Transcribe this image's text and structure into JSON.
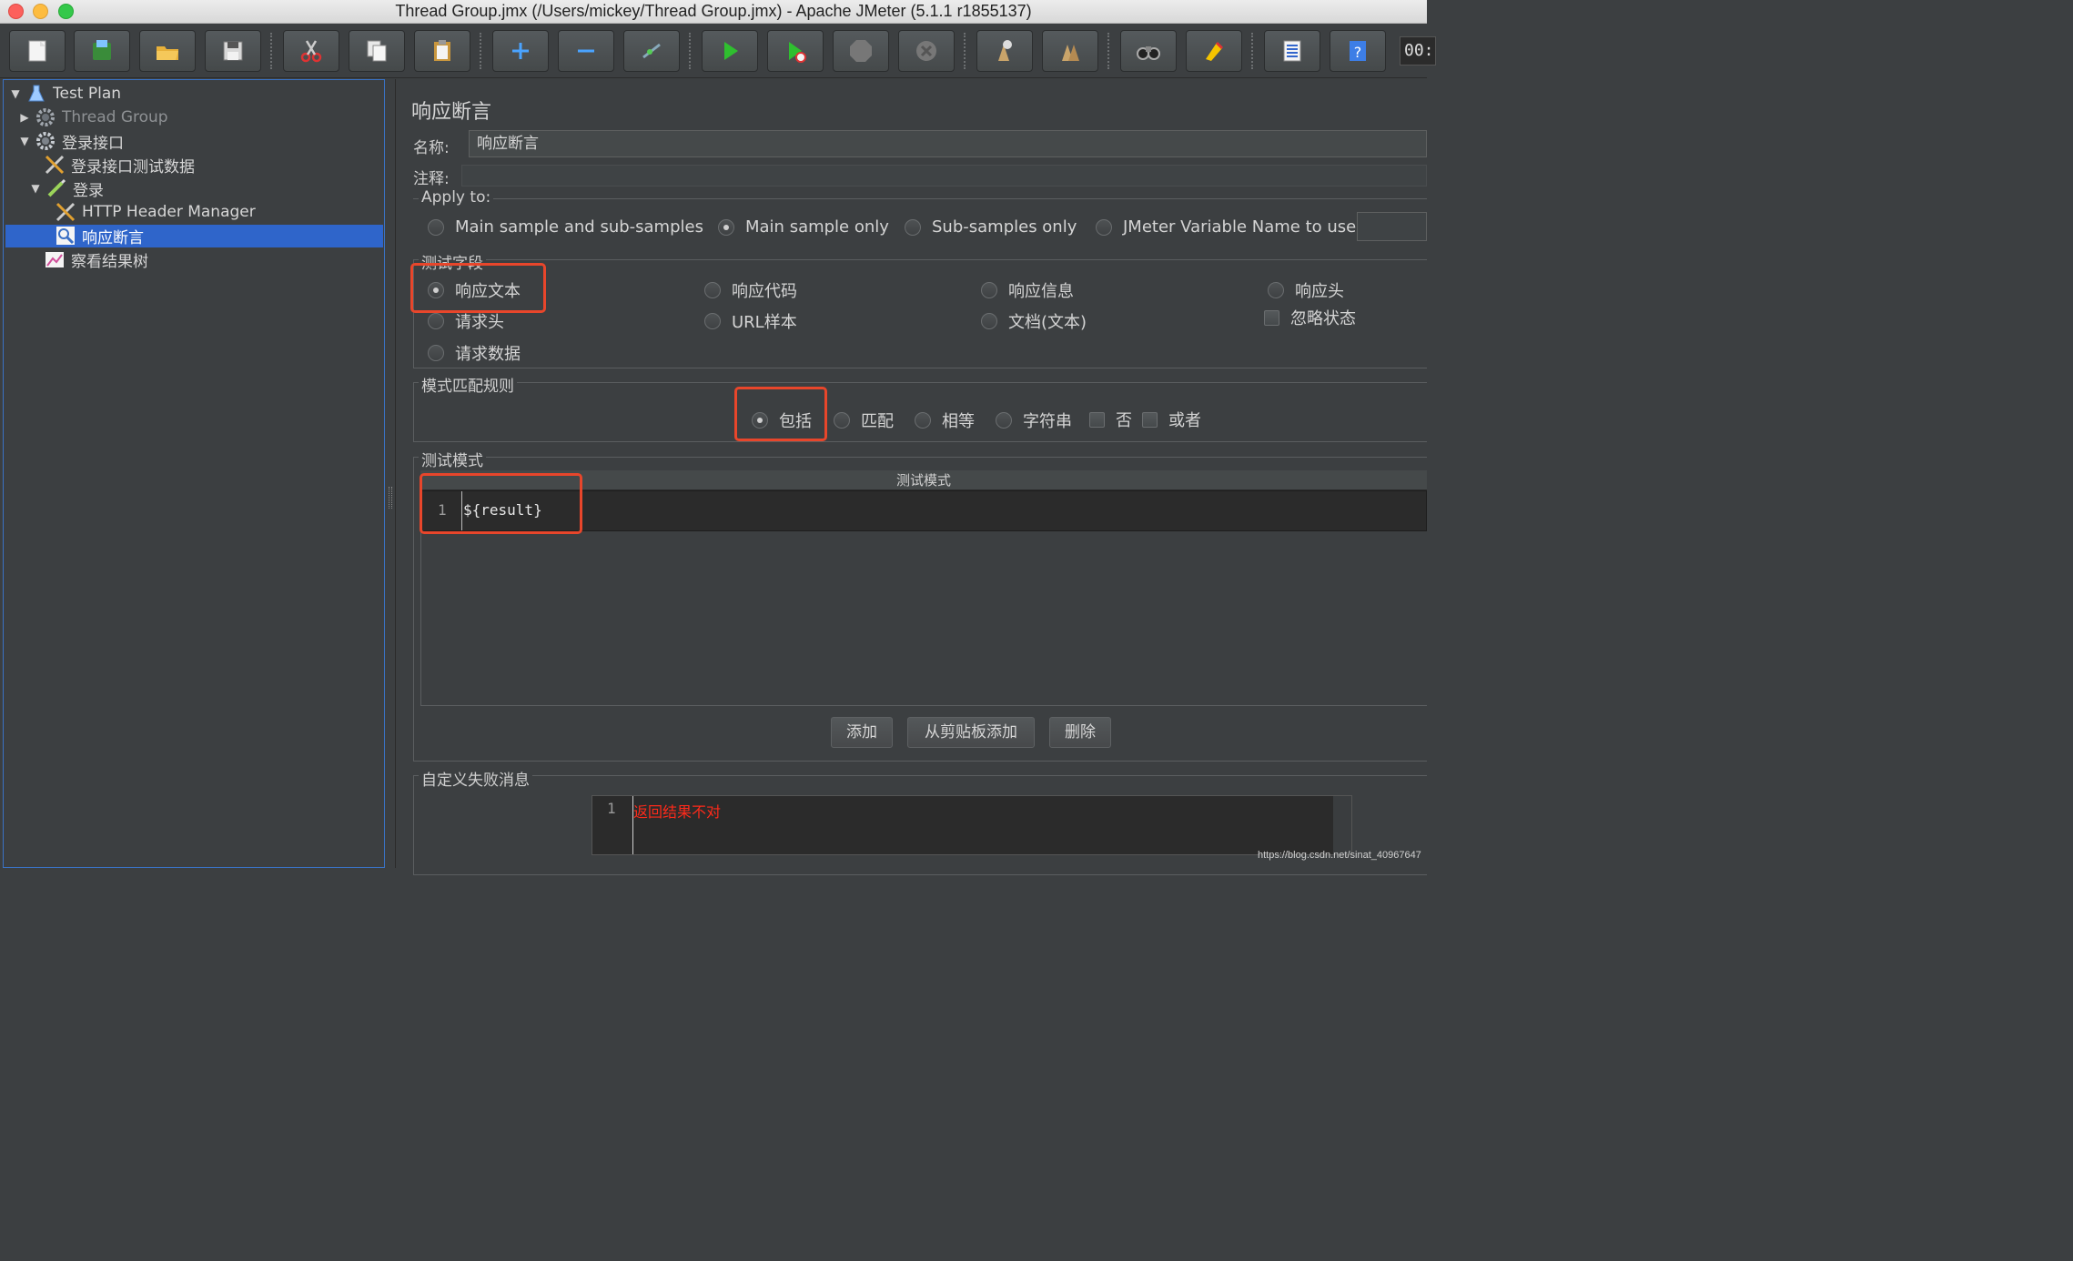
{
  "window": {
    "title": "Thread Group.jmx (/Users/mickey/Thread Group.jmx) - Apache JMeter (5.1.1 r1855137)"
  },
  "toolbar": {
    "timer": "00:",
    "buttons": [
      "new-icon",
      "templates-icon",
      "open-icon",
      "save-icon",
      "cut-icon",
      "copy-icon",
      "paste-icon",
      "expand-icon",
      "collapse-icon",
      "toggle-icon",
      "start-icon",
      "start-no-pause-icon",
      "stop-icon",
      "shutdown-icon",
      "clear-icon",
      "clear-all-icon",
      "search-icon",
      "reset-search-icon",
      "function-helper-icon",
      "help-icon"
    ]
  },
  "tree": {
    "items": [
      {
        "label": "Test Plan",
        "icon": "flask-icon"
      },
      {
        "label": "Thread Group",
        "icon": "gear-icon"
      },
      {
        "label": "登录接口",
        "icon": "gear-icon"
      },
      {
        "label": "登录接口测试数据",
        "icon": "config-wrench-icon"
      },
      {
        "label": "登录",
        "icon": "sampler-pen-icon"
      },
      {
        "label": "HTTP Header Manager",
        "icon": "config-wrench-icon"
      },
      {
        "label": "响应断言",
        "icon": "magnifier-icon"
      },
      {
        "label": "察看结果树",
        "icon": "chart-icon"
      }
    ]
  },
  "panel": {
    "title": "响应断言",
    "name_label": "名称:",
    "name_value": "响应断言",
    "comment_label": "注释:",
    "apply_to": {
      "legend": "Apply to:",
      "options": [
        "Main sample and sub-samples",
        "Main sample only",
        "Sub-samples only",
        "JMeter Variable Name to use"
      ],
      "selected": "Main sample only"
    },
    "test_field": {
      "legend": "测试字段",
      "options": [
        "响应文本",
        "响应代码",
        "响应信息",
        "响应头",
        "请求头",
        "URL样本",
        "文档(文本)",
        "请求数据"
      ],
      "checkbox": "忽略状态",
      "selected": "响应文本"
    },
    "pattern_rules": {
      "legend": "模式匹配规则",
      "options": [
        "包括",
        "匹配",
        "相等",
        "字符串"
      ],
      "checkboxes": [
        "否",
        "或者"
      ],
      "selected": "包括"
    },
    "patterns": {
      "legend": "测试模式",
      "column_header": "测试模式",
      "line_number": "1",
      "value": "${result}"
    },
    "buttons": {
      "add": "添加",
      "add_clipboard": "从剪贴板添加",
      "delete": "删除"
    },
    "failure_message": {
      "legend": "自定义失败消息",
      "line_number": "1",
      "value": "返回结果不对",
      "value_color": "#ff2a1a"
    }
  },
  "watermark": "https://blog.csdn.net/sinat_40967647",
  "colors": {
    "accent": "#2f65ca",
    "highlight": "#e8462b",
    "background": "#3c3f41"
  }
}
